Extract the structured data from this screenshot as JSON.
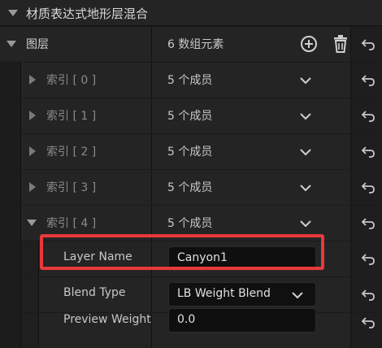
{
  "header": {
    "title": "材质表达式地形层混合"
  },
  "layers": {
    "label": "图层",
    "summary": "6 数组元素"
  },
  "indices": [
    {
      "label": "索引 [ 0 ]",
      "value": "5 个成员"
    },
    {
      "label": "索引 [ 1 ]",
      "value": "5 个成员"
    },
    {
      "label": "索引 [ 2 ]",
      "value": "5 个成员"
    },
    {
      "label": "索引 [ 3 ]",
      "value": "5 个成员"
    },
    {
      "label": "索引 [ 4 ]",
      "value": "5 个成员"
    }
  ],
  "members": {
    "layer_name": {
      "label": "Layer Name",
      "value": "Canyon1"
    },
    "blend_type": {
      "label": "Blend Type",
      "value": "LB Weight Blend"
    },
    "preview_weight": {
      "label": "Preview Weight",
      "value": "0.0"
    }
  },
  "icons": {
    "add": "plus-circle-icon",
    "delete": "trash-icon",
    "reset": "reset-arrow-icon",
    "expand": "chevron-down-icon"
  },
  "colors": {
    "highlight": "#e8393a",
    "background": "#242424"
  }
}
